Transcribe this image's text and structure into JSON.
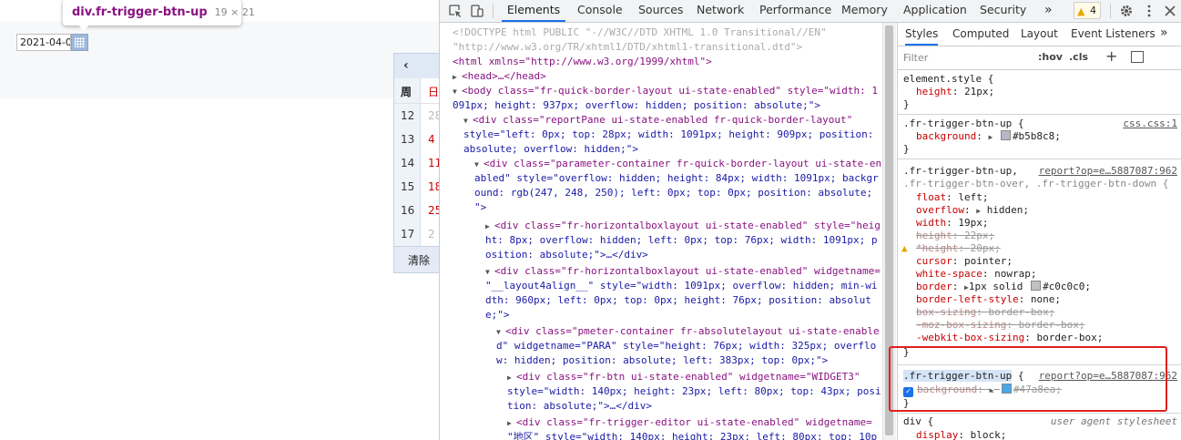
{
  "page": {
    "date_value": "2021-04-0",
    "tooltip": {
      "selector": "div.fr-trigger-btn-up",
      "size": "19 × 21"
    },
    "calendar": {
      "prev": "‹",
      "week_header": "周",
      "day_header": "日",
      "rows": [
        {
          "week": "12",
          "day": "28"
        },
        {
          "week": "13",
          "day": "4"
        },
        {
          "week": "14",
          "day": "11"
        },
        {
          "week": "15",
          "day": "18"
        },
        {
          "week": "16",
          "day": "25"
        },
        {
          "week": "17",
          "day": "2"
        }
      ],
      "clear": "清除"
    }
  },
  "devtools": {
    "tabs": [
      "Elements",
      "Console",
      "Sources",
      "Network",
      "Performance",
      "Memory",
      "Application",
      "Security"
    ],
    "more": "»",
    "warnings": "4",
    "dom_lines": [
      "<!DOCTYPE html PUBLIC \"-//W3C//DTD XHTML 1.0 Transitional//EN\"",
      "\"http://www.w3.org/TR/xhtml1/DTD/xhtml1-transitional.dtd\">",
      "<html xmlns=\"http://www.w3.org/1999/xhtml\">",
      "<head>…</head>",
      "<body class=\"fr-quick-border-layout ui-state-enabled\" style=\"width: 1",
      "091px; height: 937px; overflow: hidden; position: absolute;\">",
      "<div class=\"reportPane ui-state-enabled fr-quick-border-layout\"",
      "style=\"left: 0px; top: 28px; width: 1091px; height: 909px; position:",
      "absolute; overflow: hidden;\">",
      "<div class=\"parameter-container fr-quick-border-layout ui-state-en",
      "abled\" style=\"overflow: hidden; height: 84px; width: 1091px; backgr",
      "ound: rgb(247, 248, 250); left: 0px; top: 0px; position: absolute;",
      "\">",
      "<div class=\"fr-horizontalboxlayout ui-state-enabled\" style=\"heig",
      "ht: 8px; overflow: hidden; left: 0px; top: 76px; width: 1091px; p",
      "osition: absolute;\">…</div>",
      "<div class=\"fr-horizontalboxlayout ui-state-enabled\" widgetname=",
      "\"__layout4align__\" style=\"width: 1091px; overflow: hidden; min-wi",
      "dth: 960px; left: 0px; top: 0px; height: 76px; position: absolut",
      "e;\">",
      "<div class=\"pmeter-container fr-absolutelayout ui-state-enable",
      "d\" widgetname=\"PARA\" style=\"height: 76px; width: 325px; overflo",
      "w: hidden; position: absolute; left: 383px; top: 0px;\">",
      "<div class=\"fr-btn ui-state-enabled\" widgetname=\"WIDGET3\"",
      "style=\"width: 140px; height: 23px; left: 80px; top: 43px; posi",
      "tion: absolute;\">…</div>",
      "<div class=\"fr-trigger-editor ui-state-enabled\" widgetname=",
      "\"地区\" style=\"width: 140px; height: 23px; left: 80px; top: 10p"
    ],
    "styles_tabs": [
      "Styles",
      "Computed",
      "Layout",
      "Event Listeners",
      "»"
    ],
    "filter_placeholder": "Filter",
    "hov": ":hov",
    "cls": ".cls",
    "add": "+",
    "rules": {
      "element_style": {
        "selector": "element.style {",
        "prop": "height",
        "value": "21px;"
      },
      "rule1": {
        "selector": ".fr-trigger-btn-up {",
        "source": "css.css:1",
        "prop": "background",
        "value": "#b5b8c8;",
        "color": "#b5b8c8"
      },
      "rule2": {
        "selector1": ".fr-trigger-btn-up,",
        "selector2": ".fr-trigger-btn-over, .fr-trigger-btn-down {",
        "source": "report?op=e…5887087:962",
        "props": [
          {
            "n": "float",
            "v": "left;"
          },
          {
            "n": "overflow",
            "v": "hidden;"
          },
          {
            "n": "width",
            "v": "19px;"
          },
          {
            "n": "height",
            "v": "22px;"
          },
          {
            "n": "*height",
            "v": "20px;"
          },
          {
            "n": "cursor",
            "v": "pointer;"
          },
          {
            "n": "white-space",
            "v": "nowrap;"
          },
          {
            "n": "border",
            "v": "1px solid",
            "v2": "#c0c0c0;"
          },
          {
            "n": "border-left-style",
            "v": "none;"
          },
          {
            "n": "box-sizing",
            "v": "border-box;"
          },
          {
            "n": "-moz-box-sizing",
            "v": "border-box;"
          },
          {
            "n": "-webkit-box-sizing",
            "v": "border-box;"
          }
        ]
      },
      "rule3": {
        "selector": ".fr-trigger-btn-up",
        "brace": "{",
        "source": "report?op=e…5887087:962",
        "prop": "background",
        "value": "#47a8ea;",
        "color": "#47a8ea"
      },
      "ua_rule": {
        "selector": "div {",
        "source": "user agent stylesheet",
        "prop": "display",
        "value": "block;"
      }
    },
    "close_brace": "}",
    "colors": {
      "border_c0": "#c0c0c0"
    }
  }
}
